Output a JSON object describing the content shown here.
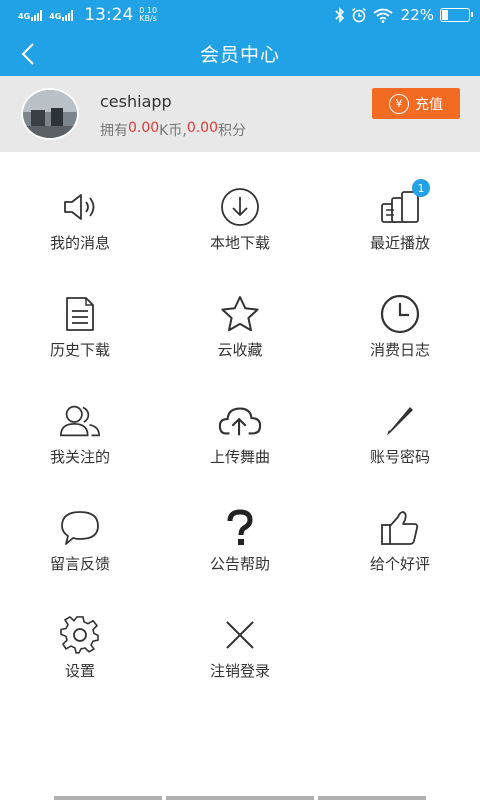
{
  "status_bar": {
    "net1": "4G",
    "net2": "4G",
    "time": "13:24",
    "speed_value": "0.10",
    "speed_unit": "KB/s",
    "battery_percent": "22%",
    "battery_level": 0.22
  },
  "header": {
    "title": "会员中心",
    "back_icon": "chevron-left-icon"
  },
  "profile": {
    "username": "ceshiapp",
    "balance_prefix": "拥有",
    "k_amount": "0.00",
    "k_unit": "K币,",
    "points_amount": "0.00",
    "points_unit": "积分",
    "recharge_symbol": "¥",
    "recharge_label": "充值"
  },
  "menu": [
    {
      "label": "我的消息",
      "icon": "speaker-icon"
    },
    {
      "label": "本地下载",
      "icon": "download-icon"
    },
    {
      "label": "最近播放",
      "icon": "recent-play-icon",
      "badge": "1"
    },
    {
      "label": "历史下载",
      "icon": "document-icon"
    },
    {
      "label": "云收藏",
      "icon": "star-icon"
    },
    {
      "label": "消费日志",
      "icon": "clock-icon"
    },
    {
      "label": "我关注的",
      "icon": "users-icon"
    },
    {
      "label": "上传舞曲",
      "icon": "cloud-upload-icon"
    },
    {
      "label": "账号密码",
      "icon": "pencil-icon"
    },
    {
      "label": "留言反馈",
      "icon": "chat-bubble-icon"
    },
    {
      "label": "公告帮助",
      "icon": "question-icon"
    },
    {
      "label": "给个好评",
      "icon": "thumbs-up-icon"
    },
    {
      "label": "设置",
      "icon": "gear-icon"
    },
    {
      "label": "注销登录",
      "icon": "close-icon"
    }
  ],
  "colors": {
    "primary": "#21a1e6",
    "accent": "#f36a23",
    "amount_red": "#e53935",
    "profile_bg": "#e8e8e8"
  }
}
